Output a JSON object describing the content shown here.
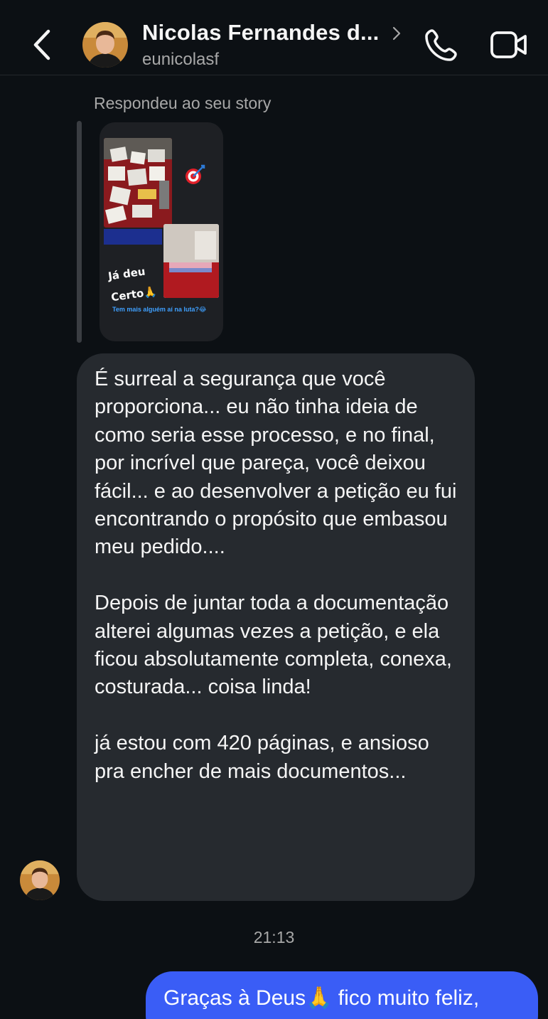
{
  "header": {
    "name": "Nicolas Fernandes d...",
    "username": "eunicolasf",
    "back_icon": "chevron-left-icon",
    "call_icon": "phone-icon",
    "video_icon": "video-camera-icon"
  },
  "story_reply": {
    "label": "Respondeu ao seu story",
    "caption_big": "Já deu Certo🙏",
    "caption_small": "Tem mais alguém aí na luta?😂"
  },
  "incoming_message": {
    "text": "É surreal a segurança que você proporciona... eu não tinha ideia de como seria esse processo, e no final, por incrível que pareça, você deixou fácil... e ao desenvolver a petição eu fui encontrando o propósito que embasou meu pedido....\n\nDepois de juntar toda a documentação alterei algumas vezes a petição, e ela ficou absolutamente completa, conexa, costurada... coisa linda!\n\njá estou com 420 páginas, e ansioso pra encher de mais documentos..."
  },
  "timestamp": "21:13",
  "outgoing_message": {
    "text": "Graças à Deus🙏 fico muito feliz,"
  },
  "colors": {
    "background": "#0c1014",
    "incoming_bubble": "#262a2f",
    "outgoing_bubble": "#3a5df6",
    "secondary_text": "#a8a8a8"
  }
}
